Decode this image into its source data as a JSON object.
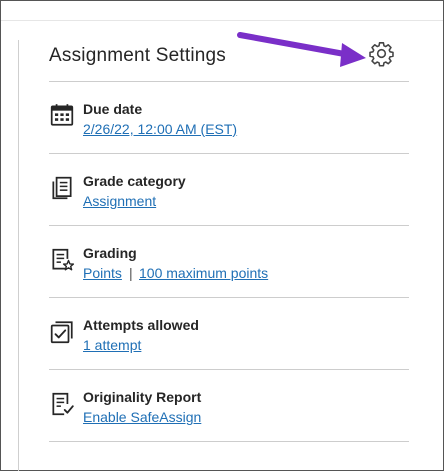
{
  "panel": {
    "title": "Assignment Settings"
  },
  "rows": [
    {
      "icon": "calendar-icon",
      "label": "Due date",
      "value": "2/26/22, 12:00 AM (EST)"
    },
    {
      "icon": "document-icon",
      "label": "Grade category",
      "value": "Assignment"
    },
    {
      "icon": "grading-star-icon",
      "label": "Grading",
      "value": "Points",
      "separator": "|",
      "value2": "100 maximum points"
    },
    {
      "icon": "checkbox-icon",
      "label": "Attempts allowed",
      "value": "1 attempt"
    },
    {
      "icon": "checklist-document-icon",
      "label": "Originality Report",
      "value": "Enable SafeAssign"
    }
  ],
  "colors": {
    "link": "#1f6fb5",
    "annotation_arrow": "#7a2fc8",
    "text": "#262626"
  }
}
